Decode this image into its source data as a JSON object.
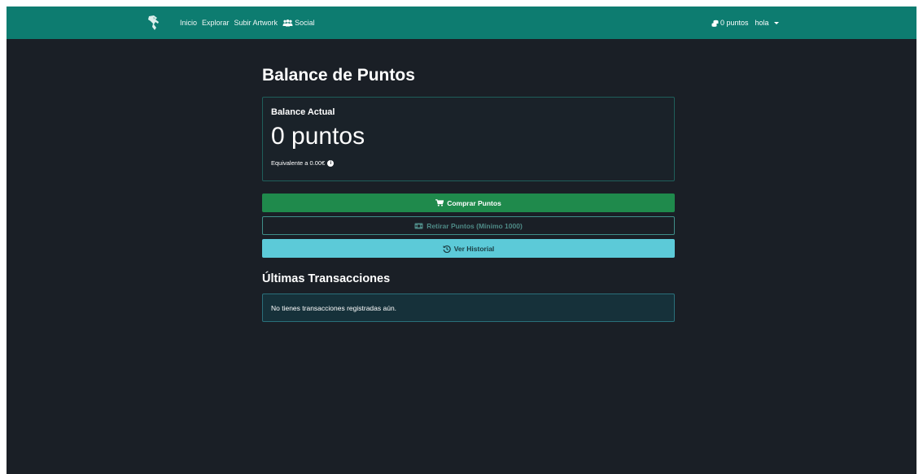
{
  "navbar": {
    "brand_icon": "horse-logo-icon",
    "links": {
      "home": "Inicio",
      "explore": "Explorar",
      "upload": "Subir Artwork",
      "social": "Social"
    },
    "points_label": "0 puntos",
    "user_label": "hola"
  },
  "page": {
    "title": "Balance de Puntos"
  },
  "balance": {
    "label": "Balance Actual",
    "value": "0 puntos",
    "equivalent": "Equivalente a 0.00€"
  },
  "actions": {
    "buy": "Comprar Puntos",
    "withdraw": "Retirar Puntos (Mínimo 1000)",
    "history": "Ver Historial"
  },
  "transactions": {
    "title": "Últimas Transacciones",
    "empty_message": "No tienes transacciones registradas aún."
  },
  "colors": {
    "navbar": "#0d7c70",
    "background": "#1a1f26",
    "buy_button": "#1f8a4c",
    "history_button": "#5ccad8"
  }
}
